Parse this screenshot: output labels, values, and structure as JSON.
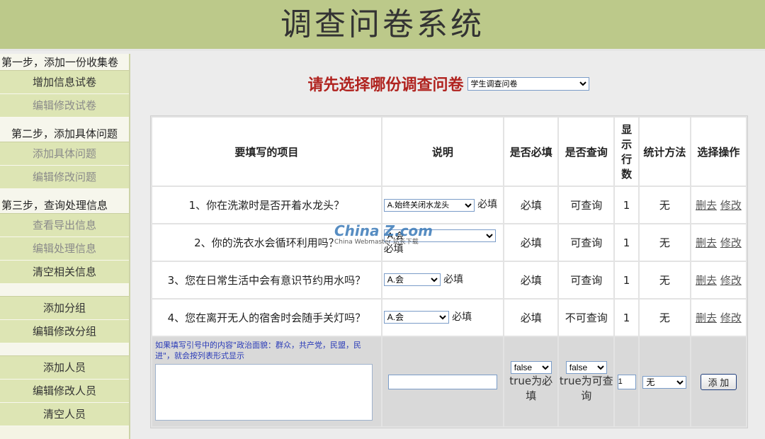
{
  "header": {
    "title": "调查问卷系统"
  },
  "sidebar": {
    "step1": "第一步，添加一份收集卷",
    "step1_items": [
      "增加信息试卷",
      "编辑修改试卷"
    ],
    "step2": "第二步，添加具体问题",
    "step2_items": [
      "添加具体问题",
      "编辑修改问题"
    ],
    "step3": "第三步，查询处理信息",
    "step3_items": [
      "查看导出信息",
      "编辑处理信息",
      "清空相关信息"
    ],
    "group_items": [
      "添加分组",
      "编辑修改分组"
    ],
    "member_items": [
      "添加人员",
      "编辑修改人员",
      "清空人员"
    ]
  },
  "main": {
    "prompt": "请先选择哪份调查问卷",
    "survey_select": "学生调查问卷"
  },
  "table": {
    "headers": [
      "要填写的项目",
      "说明",
      "是否必填",
      "是否查询",
      "显示行数",
      "统计方法",
      "选择操作"
    ],
    "header_rows_col": [
      "显",
      "示",
      "行",
      "数"
    ],
    "rows": [
      {
        "item": "1、你在洗漱时是否开着水龙头？",
        "select": "A.始终关闭水龙头",
        "desc_suffix": "必填",
        "required": "必填",
        "query": "可查询",
        "rows": "1",
        "stat": "无",
        "delete": "删去",
        "edit": "修改"
      },
      {
        "item": "2、你的洗衣水会循环利用吗？",
        "select": "A.会",
        "desc_suffix": "必填",
        "required": "必填",
        "query": "可查询",
        "rows": "1",
        "stat": "无",
        "delete": "删去",
        "edit": "修改"
      },
      {
        "item": "3、您在日常生活中会有意识节约用水吗？",
        "select": "A.会",
        "desc_suffix": "必填",
        "required": "必填",
        "query": "可查询",
        "rows": "1",
        "stat": "无",
        "delete": "删去",
        "edit": "修改"
      },
      {
        "item": "4、您在离开无人的宿舍时会随手关灯吗？",
        "select": "A.会",
        "desc_suffix": "必填",
        "required": "必填",
        "query": "不可查询",
        "rows": "1",
        "stat": "无",
        "delete": "删去",
        "edit": "修改"
      }
    ],
    "add_row": {
      "hint": "如果填写引号中的内容\"政治面貌：群众，共产党，民盟，民进\"，就会按列表形式显示",
      "required_select": "false",
      "required_note": "true为必填",
      "query_select": "false",
      "query_note": "true为可查询",
      "rows_value": "1",
      "stat_select": "无",
      "add_button": "添 加"
    }
  },
  "watermark": {
    "main": "China Z.com",
    "sub": "China Webmaster 站长下载"
  }
}
